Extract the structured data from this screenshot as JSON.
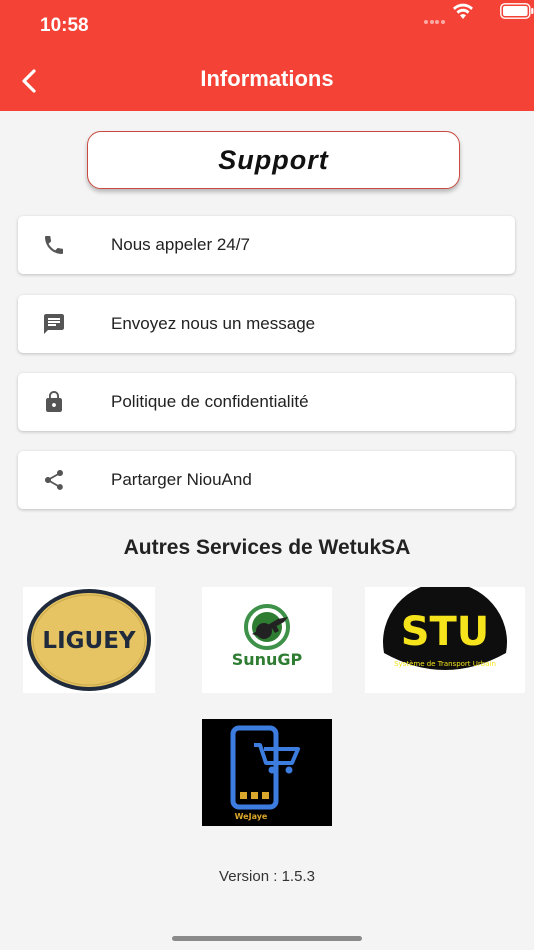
{
  "status_bar": {
    "time": "10:58"
  },
  "appbar": {
    "title": "Informations"
  },
  "support": {
    "label": "Support"
  },
  "menu": [
    {
      "label": "Nous appeler 24/7",
      "icon": "phone-icon"
    },
    {
      "label": "Envoyez nous un message",
      "icon": "message-icon"
    },
    {
      "label": "Politique de confidentialité",
      "icon": "lock-icon"
    },
    {
      "label": "Partarger NiouAnd",
      "icon": "share-icon"
    }
  ],
  "services": {
    "title": "Autres Services de WetukSA",
    "logos": [
      {
        "name": "ligueye-logo",
        "text": "LIGUEY"
      },
      {
        "name": "sunugp-logo",
        "text": "SunuGP"
      },
      {
        "name": "stu-logo",
        "text": "STU",
        "subtitle": "Système de Transport Urbain"
      },
      {
        "name": "wejaye-logo",
        "text": "WeJaye"
      }
    ]
  },
  "footer": {
    "version": "Version : 1.5.3"
  },
  "colors": {
    "primary": "#f44336",
    "icon_gray": "#555555",
    "background": "#f4f4f4"
  }
}
